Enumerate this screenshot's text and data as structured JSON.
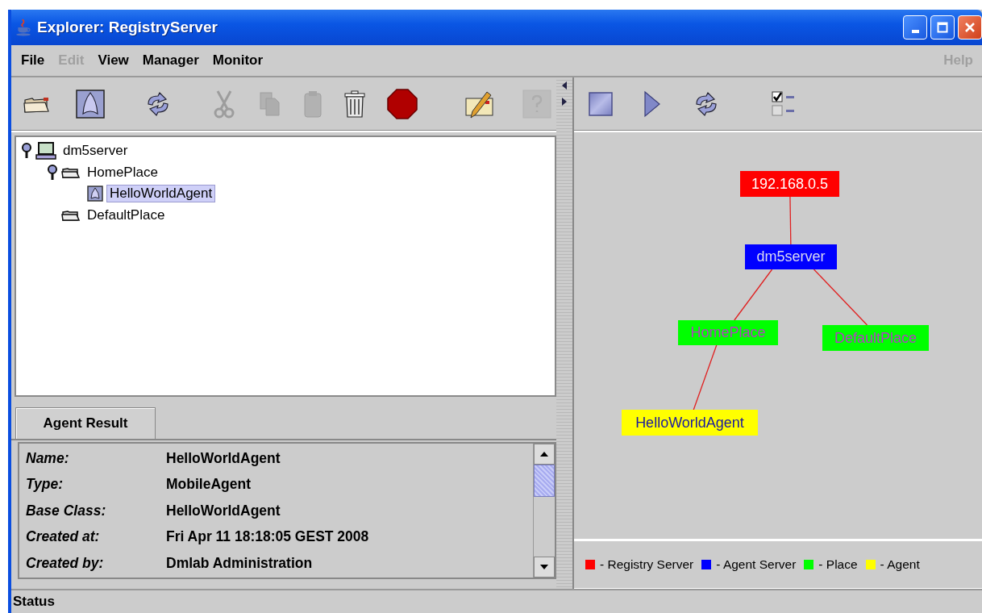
{
  "window": {
    "title": "Explorer: RegistryServer"
  },
  "menu": [
    {
      "label": "File",
      "disabled": false
    },
    {
      "label": "Edit",
      "disabled": true
    },
    {
      "label": "View",
      "disabled": false
    },
    {
      "label": "Manager",
      "disabled": false
    },
    {
      "label": "Monitor",
      "disabled": false
    }
  ],
  "help_menu": {
    "label": "Help",
    "disabled": true
  },
  "left_toolbar": [
    {
      "kind": "open",
      "disabled": false
    },
    {
      "kind": "agent",
      "disabled": false
    },
    {
      "kind": "refresh",
      "disabled": false
    },
    {
      "kind": "cut",
      "disabled": true
    },
    {
      "kind": "copy",
      "disabled": true
    },
    {
      "kind": "paste",
      "disabled": true
    },
    {
      "kind": "delete",
      "disabled": false
    },
    {
      "kind": "stop",
      "disabled": false
    },
    {
      "kind": "edit",
      "disabled": false
    },
    {
      "kind": "help",
      "disabled": true
    }
  ],
  "tree": [
    {
      "label": "dm5server",
      "kind": "server",
      "expanded": true,
      "selected": false,
      "children": [
        {
          "label": "HomePlace",
          "kind": "place",
          "expanded": true,
          "selected": false,
          "children": [
            {
              "label": "HelloWorldAgent",
              "kind": "agent",
              "selected": true
            }
          ]
        },
        {
          "label": "DefaultPlace",
          "kind": "place",
          "selected": false
        }
      ]
    }
  ],
  "result_tab": {
    "label": "Agent Result"
  },
  "details": [
    {
      "label": "Name:",
      "value": "HelloWorldAgent"
    },
    {
      "label": "Type:",
      "value": "MobileAgent"
    },
    {
      "label": "Base Class:",
      "value": "HelloWorldAgent"
    },
    {
      "label": "Created at:",
      "value": "Fri Apr 11 18:18:05 GEST 2008"
    },
    {
      "label": "Created by:",
      "value": "Dmlab Administration"
    }
  ],
  "right_toolbar": [
    {
      "kind": "stop"
    },
    {
      "kind": "play"
    },
    {
      "kind": "refresh"
    },
    {
      "kind": "checklist"
    }
  ],
  "graph": [
    {
      "label": "192.168.0.5",
      "kind": "registry",
      "color": "#ff0000",
      "children": [
        {
          "label": "dm5server",
          "kind": "server",
          "color": "#0000ff",
          "children": [
            {
              "label": "HomePlace",
              "kind": "place",
              "color": "#00ff00",
              "children": [
                {
                  "label": "HelloWorldAgent",
                  "kind": "agent",
                  "color": "#ffff00"
                }
              ]
            },
            {
              "label": "DefaultPlace",
              "kind": "place",
              "color": "#00ff00"
            }
          ]
        }
      ]
    }
  ],
  "legend": [
    {
      "label": "- Registry Server",
      "color": "#ff0000"
    },
    {
      "label": "- Agent Server",
      "color": "#0000ff"
    },
    {
      "label": "- Place",
      "color": "#00ff00"
    },
    {
      "label": "- Agent",
      "color": "#ffff00"
    }
  ],
  "status_bar": {
    "text": "Status"
  }
}
